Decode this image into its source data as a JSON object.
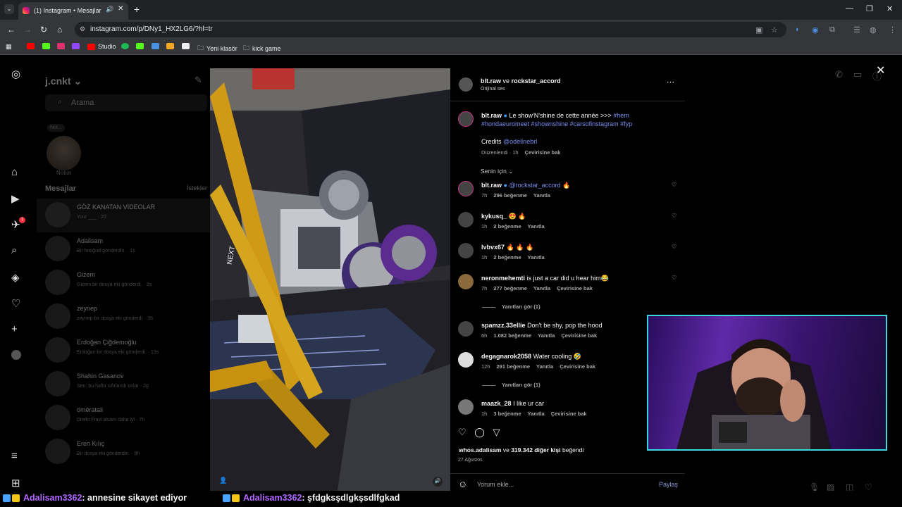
{
  "browser": {
    "tab_title": "(1) Instagram • Mesajlar",
    "url": "instagram.com/p/DNy1_HX2LG6/?hl=tr",
    "bookmarks": [
      "Studio",
      "Yeni klasör",
      "kick game"
    ]
  },
  "sidebar_dm": {
    "username": "j.cnkt",
    "search_placeholder": "Arama",
    "note_bubble": "Not...",
    "note_label": "Notun",
    "messages_label": "Mesajlar",
    "requests_label": "İstekler",
    "threads": [
      {
        "name": "GÖZ KANATAN VİDEOLAR",
        "preview": "Your ___ · 2d"
      },
      {
        "name": "Adalisam",
        "preview": "Bir fotoğraf gönderdin. · 1s"
      },
      {
        "name": "Gizem",
        "preview": "Gizem bir dosya eki gönderdi. · 2s"
      },
      {
        "name": "zeynep",
        "preview": "zeynep bir dosya eki gönderdi. · 8s"
      },
      {
        "name": "Erdoğan Çiğdemoğlu",
        "preview": "Erdoğan bir dosya eki gönderdi. · 13s"
      },
      {
        "name": "Shahin Gasanov",
        "preview": "Sen: bu hafta sıfırlandı onlar · 2g"
      },
      {
        "name": "ömeratali",
        "preview": "Direkt Fmyi alsam daha iyi · 7h"
      },
      {
        "name": "Eren Kılıç",
        "preview": "Bir dosya eki gönderdin. · 9h"
      }
    ],
    "notification_badge": "1"
  },
  "post": {
    "header_title_a": "blt.raw",
    "header_and": "ve",
    "header_title_b": "rockstar_accord",
    "header_sub": "Orijinal ses",
    "caption_user": "blt.raw",
    "caption_text": "Le show'N'shine de cette année >>>",
    "caption_tags": "#hem #hondaeuromeet #shownshine #carsofinstagram #fyp",
    "credits_label": "Credits",
    "credits_user": "@odelinebrl",
    "caption_meta_edited": "Düzenlendi · 1h",
    "caption_meta_translate": "Çevirisine bak",
    "sort_label": "Senin için",
    "comments": [
      {
        "user": "blt.raw",
        "text": "@rockstar_accord 🔥",
        "time": "7h",
        "likes": "296 beğenme",
        "reply": "Yanıtla",
        "translate": ""
      },
      {
        "user": "kykusq_",
        "text": "😍 🔥",
        "time": "1h",
        "likes": "2 beğenme",
        "reply": "Yanıtla",
        "translate": ""
      },
      {
        "user": "lvbvx67",
        "text": "🔥 🔥 🔥",
        "time": "1h",
        "likes": "2 beğenme",
        "reply": "Yanıtla",
        "translate": ""
      },
      {
        "user": "neronmehemti",
        "text": "is just a car did u hear him😂",
        "time": "7h",
        "likes": "277 beğenme",
        "reply": "Yanıtla",
        "translate": "Çevirisine bak"
      },
      {
        "user": "spamzz.33ellie",
        "text": "Don't be shy, pop the hood",
        "time": "6h",
        "likes": "1.082 beğenme",
        "reply": "Yanıtla",
        "translate": "Çevirisine bak"
      },
      {
        "user": "degagnarok2058",
        "text": "Water cooling 🤣",
        "time": "12h",
        "likes": "291 beğenme",
        "reply": "Yanıtla",
        "translate": "Çevirisine bak"
      },
      {
        "user": "maazk_28",
        "text": "I like ur car",
        "time": "1h",
        "likes": "3 beğenme",
        "reply": "Yanıtla",
        "translate": "Çevirisine bak"
      }
    ],
    "see_replies": "Yanıtları gör (1)",
    "likes_user": "whos.adalisam",
    "likes_and": "ve",
    "likes_count": "319.342 diğer kişi",
    "likes_suffix": "beğendi",
    "date": "27 Ağustos",
    "comment_placeholder": "Yorum ekle...",
    "share_label": "Paylaş",
    "video_overlay_text": "NEXT"
  },
  "chat": [
    {
      "user": "Adalisam3362",
      "message": ": annesine sikayet ediyor"
    },
    {
      "user": "Adalisam3362",
      "message": ": şfdgksşdlgkşsdlfgkad"
    }
  ]
}
